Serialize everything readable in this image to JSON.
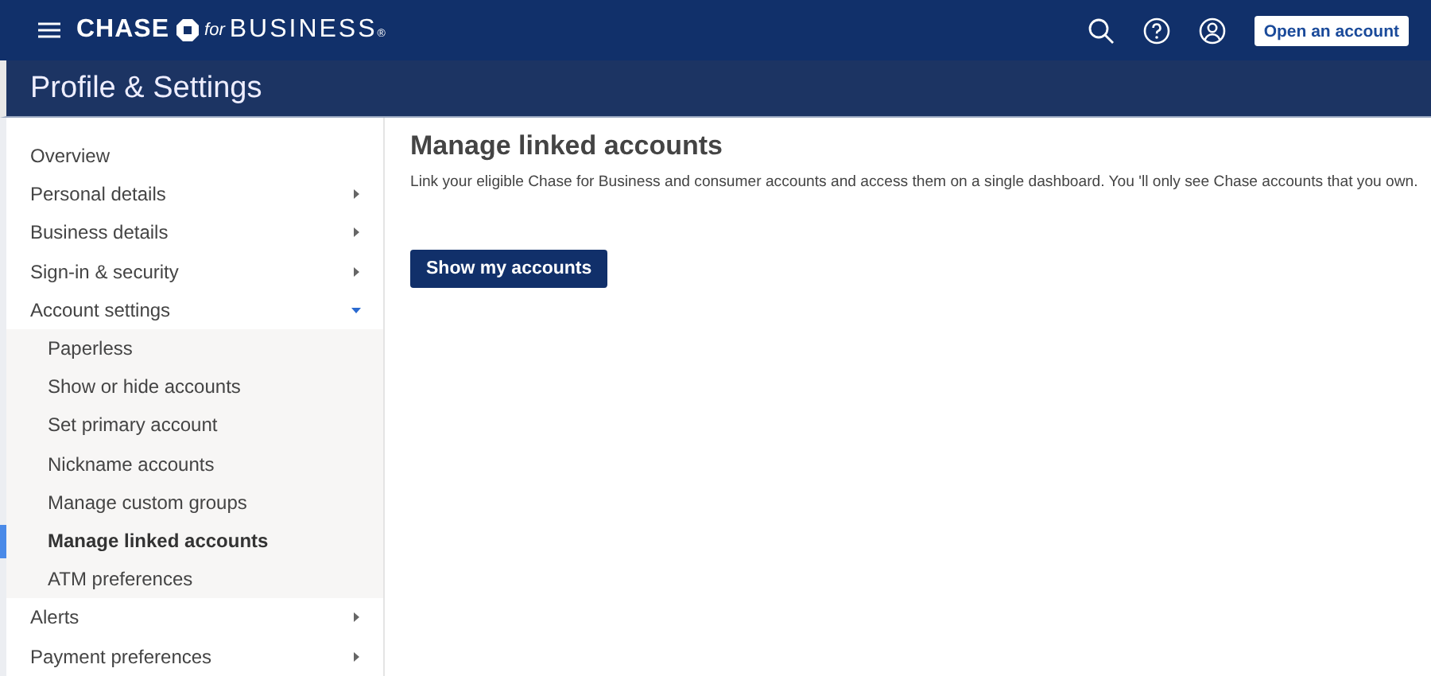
{
  "header": {
    "logo": {
      "brand": "CHASE",
      "for": "for",
      "business": "BUSINESS",
      "mark": "®"
    },
    "open_account_button": "Open an account"
  },
  "page_title": "Profile & Settings",
  "sidebar": {
    "items": [
      {
        "label": "Overview",
        "selected": false
      },
      {
        "label": "Personal details",
        "selected": false,
        "expanded": false
      },
      {
        "label": "Business details",
        "selected": false,
        "expanded": false
      },
      {
        "label": "Sign-in & security",
        "selected": false,
        "expanded": false
      },
      {
        "label": "Account settings",
        "selected": false,
        "expanded": true,
        "children": [
          {
            "label": "Paperless",
            "selected": false
          },
          {
            "label": "Show or hide accounts",
            "selected": false
          },
          {
            "label": "Set primary account",
            "selected": false
          },
          {
            "label": "Nickname accounts",
            "selected": false
          },
          {
            "label": "Manage custom groups",
            "selected": false
          },
          {
            "label": "Manage linked accounts",
            "selected": true
          },
          {
            "label": "ATM preferences",
            "selected": false
          }
        ]
      },
      {
        "label": "Alerts",
        "selected": false,
        "expanded": false
      },
      {
        "label": "Payment preferences",
        "selected": false,
        "expanded": false
      }
    ]
  },
  "content": {
    "heading": "Manage linked accounts",
    "description": "Link your eligible Chase for Business and consumer accounts and access them on a single dashboard. You 'll only see Chase accounts that you own.",
    "button": "Show my accounts"
  }
}
